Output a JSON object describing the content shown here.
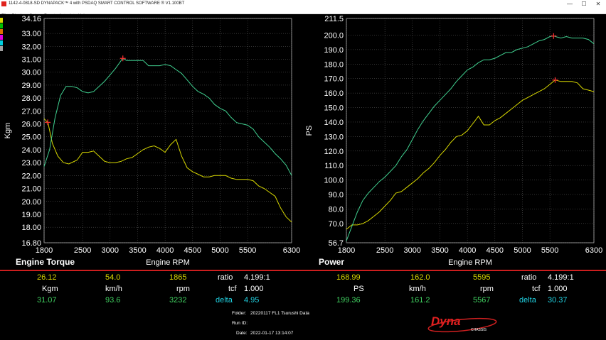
{
  "window": {
    "title": "1142-4-0818-SD DYNAPACK™ 4 with PSDAQ SMART CONTROL SOFTWARE ® V1.100BT",
    "min": "—",
    "max": "☐",
    "close": "✕"
  },
  "menu": [
    "File",
    "Display",
    "Setup",
    "Reset",
    "Autoplot",
    "Help"
  ],
  "legend_colors": [
    "#d8d800",
    "#00c000",
    "#e07000",
    "#e000e0",
    "#00d0e0",
    "#a0a0a0"
  ],
  "charts": {
    "torque": {
      "ylabel": "Kgm",
      "xlabel": "Engine RPM",
      "title": "Engine Torque",
      "yticks": [
        "34.16",
        "33.00",
        "32.00",
        "31.00",
        "30.00",
        "29.00",
        "28.00",
        "27.00",
        "26.00",
        "25.00",
        "24.00",
        "23.00",
        "22.00",
        "21.00",
        "20.00",
        "19.00",
        "18.00",
        "16.80"
      ],
      "xticks": [
        "1800",
        "2500",
        "3000",
        "3500",
        "4000",
        "4500",
        "5000",
        "5500",
        "6300"
      ]
    },
    "power": {
      "ylabel": "PS",
      "xlabel": "Engine RPM",
      "title": "Power",
      "yticks": [
        "211.5",
        "200.0",
        "190.0",
        "180.0",
        "170.0",
        "160.0",
        "150.0",
        "140.0",
        "130.0",
        "120.0",
        "110.0",
        "100.0",
        "90.0",
        "80.0",
        "70.0",
        "56.7"
      ],
      "xticks": [
        "1800",
        "2500",
        "3000",
        "3500",
        "4000",
        "4500",
        "5000",
        "5500",
        "6300"
      ]
    }
  },
  "chart_data": [
    {
      "type": "line",
      "title": "Engine Torque",
      "xlabel": "Engine RPM",
      "ylabel": "Kgm",
      "xlim": [
        1800,
        6300
      ],
      "ylim": [
        16.8,
        34.16
      ],
      "series": [
        {
          "color": "#d8d800",
          "x": [
            1800,
            1870,
            1950,
            2050,
            2150,
            2250,
            2400,
            2500,
            2600,
            2700,
            2800,
            2900,
            3000,
            3100,
            3200,
            3300,
            3400,
            3500,
            3600,
            3700,
            3800,
            3900,
            4000,
            4100,
            4200,
            4300,
            4400,
            4500,
            4600,
            4700,
            4800,
            4900,
            5000,
            5100,
            5200,
            5300,
            5400,
            5500,
            5600,
            5700,
            5800,
            5900,
            6000,
            6100,
            6200,
            6300
          ],
          "y": [
            26.4,
            26.1,
            24.5,
            23.5,
            23.0,
            22.9,
            23.2,
            23.8,
            23.8,
            23.9,
            23.5,
            23.1,
            23.0,
            23.0,
            23.1,
            23.3,
            23.4,
            23.7,
            24.0,
            24.2,
            24.3,
            24.1,
            23.8,
            24.4,
            24.8,
            23.5,
            22.6,
            22.3,
            22.1,
            21.9,
            21.9,
            22.0,
            22.0,
            22.0,
            21.8,
            21.7,
            21.7,
            21.7,
            21.6,
            21.2,
            21.0,
            20.7,
            20.4,
            19.5,
            18.8,
            18.4
          ]
        },
        {
          "color": "#40d090",
          "x": [
            1800,
            1900,
            2000,
            2100,
            2200,
            2300,
            2400,
            2500,
            2600,
            2700,
            2800,
            2900,
            3000,
            3100,
            3200,
            3232,
            3300,
            3400,
            3500,
            3600,
            3700,
            3800,
            3900,
            4000,
            4100,
            4200,
            4300,
            4400,
            4500,
            4600,
            4700,
            4800,
            4900,
            5000,
            5100,
            5200,
            5300,
            5400,
            5500,
            5600,
            5700,
            5800,
            5900,
            6000,
            6100,
            6200,
            6300
          ],
          "y": [
            22.7,
            24.0,
            26.5,
            28.2,
            28.9,
            28.9,
            28.8,
            28.5,
            28.4,
            28.5,
            28.9,
            29.3,
            29.8,
            30.3,
            30.9,
            31.07,
            30.9,
            30.9,
            30.9,
            30.9,
            30.5,
            30.5,
            30.5,
            30.6,
            30.5,
            30.2,
            29.9,
            29.4,
            28.9,
            28.5,
            28.3,
            28.0,
            27.5,
            27.2,
            27.0,
            26.5,
            26.1,
            26.0,
            25.9,
            25.6,
            25.0,
            24.6,
            24.2,
            23.7,
            23.3,
            22.8,
            22.0
          ]
        }
      ],
      "markers": [
        {
          "x": 1865,
          "y": 26.12
        },
        {
          "x": 3232,
          "y": 31.07
        }
      ]
    },
    {
      "type": "line",
      "title": "Power",
      "xlabel": "Engine RPM",
      "ylabel": "PS",
      "xlim": [
        1800,
        6300
      ],
      "ylim": [
        56.7,
        211.5
      ],
      "series": [
        {
          "color": "#d8d800",
          "x": [
            1800,
            1900,
            2000,
            2100,
            2200,
            2300,
            2400,
            2500,
            2600,
            2700,
            2800,
            2900,
            3000,
            3100,
            3200,
            3300,
            3400,
            3500,
            3600,
            3700,
            3800,
            3900,
            4000,
            4100,
            4200,
            4300,
            4400,
            4500,
            4600,
            4700,
            4800,
            4900,
            5000,
            5100,
            5200,
            5300,
            5400,
            5500,
            5595,
            5700,
            5800,
            5900,
            6000,
            6100,
            6200,
            6300
          ],
          "y": [
            66,
            69,
            69,
            70,
            72,
            75,
            78,
            82,
            86,
            91,
            92,
            95,
            98,
            101,
            105,
            108,
            112,
            117,
            121,
            126,
            130,
            131,
            134,
            139,
            144,
            138,
            138,
            141,
            143,
            146,
            149,
            152,
            155,
            157,
            159,
            161,
            163,
            166,
            169,
            168,
            168,
            168,
            167,
            163,
            162,
            161
          ]
        },
        {
          "color": "#40d090",
          "x": [
            1800,
            1900,
            2000,
            2100,
            2200,
            2300,
            2400,
            2500,
            2600,
            2700,
            2800,
            2900,
            3000,
            3100,
            3200,
            3300,
            3400,
            3500,
            3600,
            3700,
            3800,
            3900,
            4000,
            4100,
            4200,
            4300,
            4400,
            4500,
            4600,
            4700,
            4800,
            4900,
            5000,
            5100,
            5200,
            5300,
            5400,
            5500,
            5567,
            5600,
            5700,
            5800,
            5900,
            6000,
            6100,
            6200,
            6300
          ],
          "y": [
            58,
            68,
            78,
            86,
            91,
            95,
            99,
            102,
            106,
            110,
            116,
            121,
            128,
            135,
            141,
            146,
            151,
            155,
            159,
            163,
            168,
            172,
            176,
            178,
            181,
            183,
            183,
            184,
            186,
            188,
            188,
            190,
            191,
            192,
            194,
            196,
            197,
            199,
            199.4,
            199,
            198,
            199,
            198,
            198,
            198,
            197,
            194
          ]
        }
      ],
      "markers": [
        {
          "x": 5595,
          "y": 168.99
        },
        {
          "x": 5567,
          "y": 199.36
        }
      ]
    }
  ],
  "readouts": {
    "left": {
      "row1": {
        "a": "26.12",
        "b": "54.0",
        "c": "1865",
        "label": "ratio",
        "value": "4.199:1"
      },
      "units": {
        "a": "Kgm",
        "b": "km/h",
        "c": "rpm",
        "label": "tcf",
        "value": "1.000"
      },
      "row2": {
        "a": "31.07",
        "b": "93.6",
        "c": "3232",
        "label": "delta",
        "value": "4.95"
      }
    },
    "right": {
      "row1": {
        "a": "168.99",
        "b": "162.0",
        "c": "5595",
        "label": "ratio",
        "value": "4.199:1"
      },
      "units": {
        "a": "PS",
        "b": "km/h",
        "c": "rpm",
        "label": "tcf",
        "value": "1.000"
      },
      "row2": {
        "a": "199.36",
        "b": "161.2",
        "c": "5567",
        "label": "delta",
        "value": "30.37"
      }
    }
  },
  "info": {
    "folder_label": "Folder:",
    "folder": "20220117 FL1 Tsurushi Data",
    "runid_label": "Run ID:",
    "runid": "",
    "date_label": "Date:",
    "date": "2022-01-17 13:14:07"
  },
  "logo": {
    "text": "Dyna",
    "sub": "CHASSIS"
  },
  "colors": {
    "yellow": "#d8d800",
    "green": "#40d090",
    "accent_red": "#cc1e1e",
    "marker": "#ff3030"
  }
}
